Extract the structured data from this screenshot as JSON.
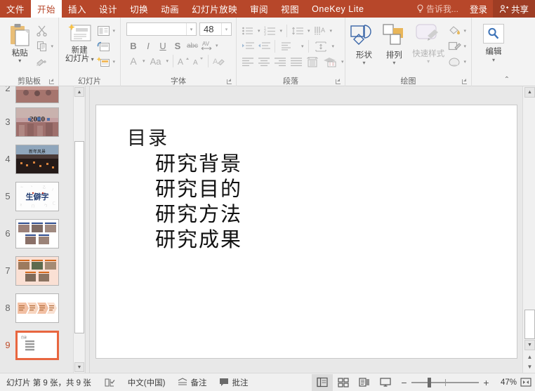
{
  "tabs": [
    {
      "label": "文件",
      "active": false,
      "name": "tab-file"
    },
    {
      "label": "开始",
      "active": true,
      "name": "tab-home"
    },
    {
      "label": "插入",
      "active": false,
      "name": "tab-insert"
    },
    {
      "label": "设计",
      "active": false,
      "name": "tab-design"
    },
    {
      "label": "切换",
      "active": false,
      "name": "tab-transitions"
    },
    {
      "label": "动画",
      "active": false,
      "name": "tab-animations"
    },
    {
      "label": "幻灯片放映",
      "active": false,
      "name": "tab-slideshow"
    },
    {
      "label": "审阅",
      "active": false,
      "name": "tab-review"
    },
    {
      "label": "视图",
      "active": false,
      "name": "tab-view"
    },
    {
      "label": "OneKey Lite",
      "active": false,
      "name": "tab-onekey-lite"
    }
  ],
  "titlebar": {
    "tell_me": "告诉我...",
    "tell_me_icon": "lightbulb-icon",
    "sign_in": "登录",
    "share": "共享",
    "share_icon": "person-share-icon"
  },
  "ribbon": {
    "clipboard": {
      "group_label": "剪贴板",
      "paste_label": "粘贴",
      "paste_icon": "paste-clipboard-icon",
      "cut_icon": "scissors-icon",
      "copy_icon": "copy-icon",
      "format_painter_icon": "format-painter-icon",
      "launcher_icon": "dialog-launcher-icon"
    },
    "slides": {
      "group_label": "幻灯片",
      "new_slide_label": "新建\n幻灯片",
      "new_slide_line1": "新建",
      "new_slide_line2": "幻灯片",
      "new_slide_icon": "new-slide-icon",
      "layout_icon": "slide-layout-icon",
      "reset_icon": "reset-slide-icon",
      "section_icon": "section-icon"
    },
    "font": {
      "group_label": "字体",
      "font_name_value": "",
      "font_name_placeholder": "",
      "font_size_value": "48",
      "bold": "B",
      "italic": "I",
      "underline": "U",
      "shadow": "S",
      "strikethrough": "abc",
      "char_spacing": "AV",
      "font_color_icon": "font-color-icon",
      "change_case": "Aa",
      "grow_font": "A",
      "shrink_font": "A",
      "clear_format_icon": "clear-formatting-icon",
      "launcher_icon": "dialog-launcher-icon"
    },
    "paragraph": {
      "group_label": "段落",
      "icons": [
        "bullets-icon",
        "numbering-icon",
        "line-spacing-icon",
        "text-direction-icon",
        "decrease-indent-icon",
        "increase-indent-icon",
        "paragraph-spacing-icon",
        "align-text-icon",
        "align-left-icon",
        "align-center-icon",
        "align-right-icon",
        "justify-icon",
        "columns-icon",
        "convert-smartart-icon"
      ],
      "launcher_icon": "dialog-launcher-icon"
    },
    "drawing": {
      "group_label": "绘图",
      "shapes_label": "形状",
      "shapes_icon": "shapes-icon",
      "arrange_label": "排列",
      "arrange_icon": "arrange-icon",
      "quick_styles_label": "快速样式",
      "quick_styles_icon": "quick-styles-icon",
      "shape_fill_icon": "shape-fill-icon",
      "shape_outline_icon": "shape-outline-icon",
      "shape_effects_icon": "shape-effects-icon",
      "launcher_icon": "dialog-launcher-icon"
    },
    "editing": {
      "group_label": "",
      "edit_label": "编辑",
      "edit_icon": "magnifier-icon"
    },
    "collapse_icon": "chevron-up-icon"
  },
  "thumbnails": [
    {
      "number": "2",
      "selected": false,
      "kind": "photo-dark"
    },
    {
      "number": "3",
      "selected": false,
      "kind": "photo-2020",
      "caption": "2020"
    },
    {
      "number": "4",
      "selected": false,
      "kind": "photo-night"
    },
    {
      "number": "5",
      "selected": false,
      "kind": "text-shengpizi",
      "caption": "生僻字"
    },
    {
      "number": "6",
      "selected": false,
      "kind": "photo-grid-blue"
    },
    {
      "number": "7",
      "selected": false,
      "kind": "photo-grid-orange"
    },
    {
      "number": "8",
      "selected": false,
      "kind": "process-chevrons"
    },
    {
      "number": "9",
      "selected": true,
      "kind": "contents-outline"
    }
  ],
  "slide": {
    "title": "目录",
    "items": [
      "研究背景",
      "研究目的",
      "研究方法",
      "研究成果"
    ]
  },
  "status": {
    "slide_count_text": "幻灯片 第 9 张，共 9 张",
    "spellcheck_icon": "spellcheck-icon",
    "language": "中文(中国)",
    "notes_label": "备注",
    "notes_icon": "notes-icon",
    "comments_label": "批注",
    "comments_icon": "comment-icon",
    "views": [
      {
        "name": "view-normal",
        "icon": "normal-view-icon",
        "active": true
      },
      {
        "name": "view-slide-sorter",
        "icon": "slide-sorter-icon",
        "active": false
      },
      {
        "name": "view-reading",
        "icon": "reading-view-icon",
        "active": false
      },
      {
        "name": "view-slideshow",
        "icon": "slideshow-icon",
        "active": false
      }
    ],
    "zoom_out": "−",
    "zoom_in": "+",
    "zoom_percent": "47%",
    "fit_icon": "fit-to-window-icon"
  },
  "colors": {
    "ribbon_red": "#B7472A",
    "share_red": "#9E3D24",
    "selection_orange": "#E8663F",
    "workspace_gray": "#E8E8E8",
    "ribbon_bg": "#F3F3F3"
  }
}
